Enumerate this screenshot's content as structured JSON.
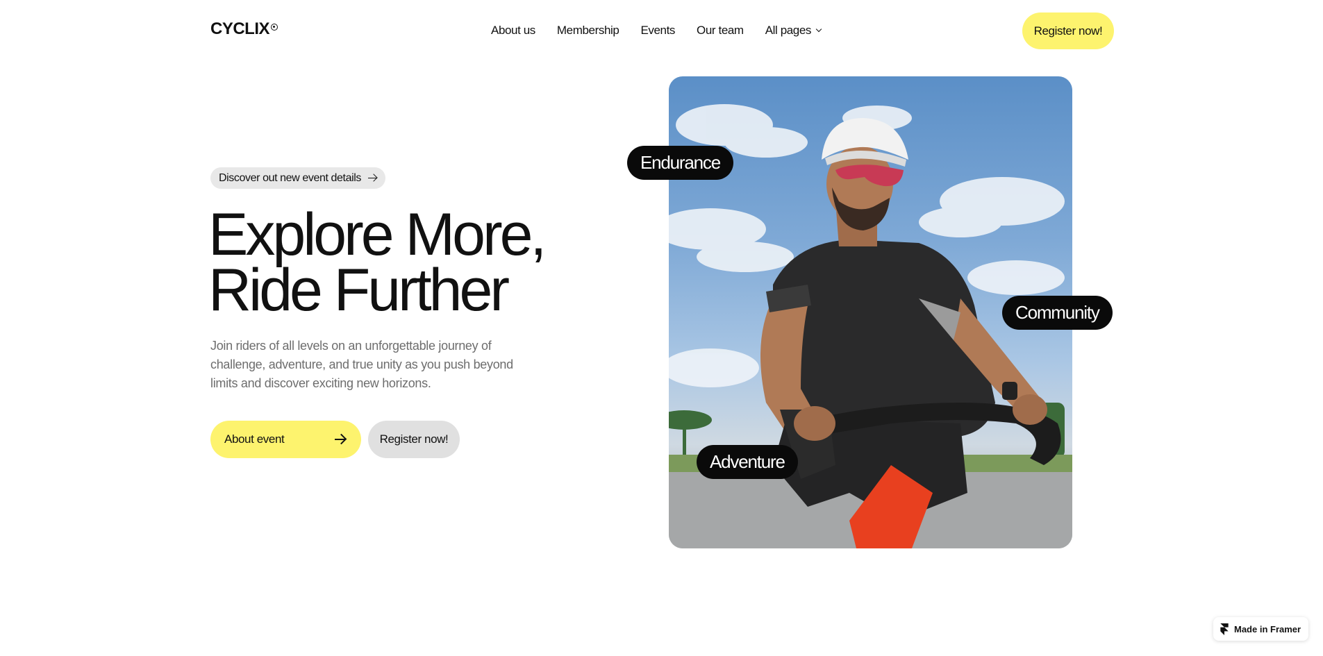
{
  "header": {
    "logo": "CYCLIX",
    "nav": [
      {
        "label": "About us"
      },
      {
        "label": "Membership"
      },
      {
        "label": "Events"
      },
      {
        "label": "Our team"
      },
      {
        "label": "All pages",
        "icon": "chevron-down-icon"
      }
    ],
    "register_label": "Register now!"
  },
  "hero": {
    "pill_label": "Discover out new event details",
    "title_line1": "Explore More,",
    "title_line2": "Ride Further",
    "description": "Join riders of all levels on an unforgettable journey of challenge, adventure, and true unity as you push beyond limits and discover exciting new horizons.",
    "about_button": "About event",
    "register_button": "Register now!"
  },
  "image_tags": {
    "endurance": "Endurance",
    "community": "Community",
    "adventure": "Adventure"
  },
  "badge": {
    "label": "Made in Framer"
  },
  "colors": {
    "accent_yellow": "#fdf36e",
    "tag_black": "#0a0a0a",
    "secondary_gray": "#e0e0e0",
    "text_muted": "#6d6d6d"
  }
}
